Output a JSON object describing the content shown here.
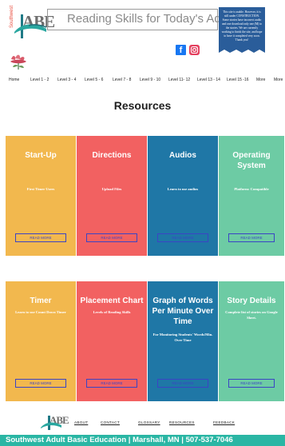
{
  "header": {
    "logo_letters": "ABE",
    "logo_side_text": "Southwest",
    "site_title": "Reading Skills for Today's Adults",
    "notice": "This site is usable. However, it is still under CONSTRUCTION. Some stories have incorrect audio and one download only one (M) to the stories. We are currently working to finish the site, and hope to have it completed very soon. Thank you!",
    "facebook_label": "f"
  },
  "nav": {
    "items": [
      "Home",
      "Level 1 - 2",
      "Level 3 - 4",
      "Level 5 - 6",
      "Level 7 - 8",
      "Level 9 - 10",
      "Level 11- 12",
      "Level 13 - 14",
      "Level 15 -16",
      "More",
      "More"
    ]
  },
  "main": {
    "heading": "Resources",
    "read_more": "READ MORE",
    "cards": [
      {
        "title": "Start-Up",
        "subtitle": "First Timer Users",
        "color": "#f2b84e"
      },
      {
        "title": "Directions",
        "subtitle": "Upload Files",
        "color": "#f26161"
      },
      {
        "title": "Audios",
        "subtitle": "Learn to use audios",
        "color": "#1f77a6"
      },
      {
        "title": "Operating System",
        "subtitle": "Platform: Compatible",
        "color": "#6dcba4"
      },
      {
        "title": "Timer",
        "subtitle": "Learn to use Count Down Timer",
        "color": "#f2b84e"
      },
      {
        "title": "Placement Chart",
        "subtitle": "Levels of Reading Skills",
        "color": "#f26161"
      },
      {
        "title": "Graph of Words Per Minute Over Time",
        "subtitle": "For Monitoring Students' Words/Min. Over Time",
        "color": "#1f77a6"
      },
      {
        "title": "Story Details",
        "subtitle": "Complete list of stories on Google Sheet.",
        "color": "#6dcba4"
      }
    ]
  },
  "footer": {
    "logo_letters": "ABE",
    "links": [
      "ABOUT",
      "CONTACT",
      "GLOSSARY",
      "RESOURCES",
      "FEEDBACK"
    ],
    "bar_text": "Southwest Adult Basic Education  |  Marshall, MN  |  507-537-7046"
  }
}
